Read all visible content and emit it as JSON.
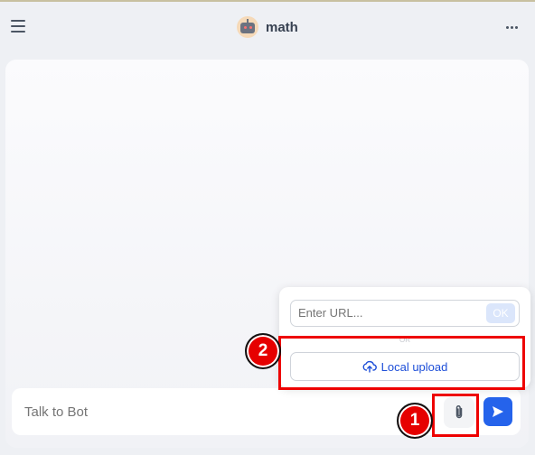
{
  "header": {
    "bot_name": "math",
    "menu_icon": "hamburger-menu-icon",
    "more_icon": "more-horizontal-icon",
    "avatar_icon": "robot-avatar-icon"
  },
  "composer": {
    "placeholder": "Talk to Bot",
    "attach_icon": "paperclip-icon",
    "send_icon": "send-arrow-icon"
  },
  "upload_popup": {
    "url_placeholder": "Enter URL...",
    "ok_label": "OK",
    "divider_label": "OR",
    "local_upload_label": "Local upload",
    "local_upload_icon": "cloud-upload-icon"
  },
  "annotations": [
    {
      "label": "1",
      "target": "attach-button"
    },
    {
      "label": "2",
      "target": "local-upload-button"
    }
  ],
  "colors": {
    "accent": "#2563eb",
    "annotation_red": "#ee0000"
  }
}
